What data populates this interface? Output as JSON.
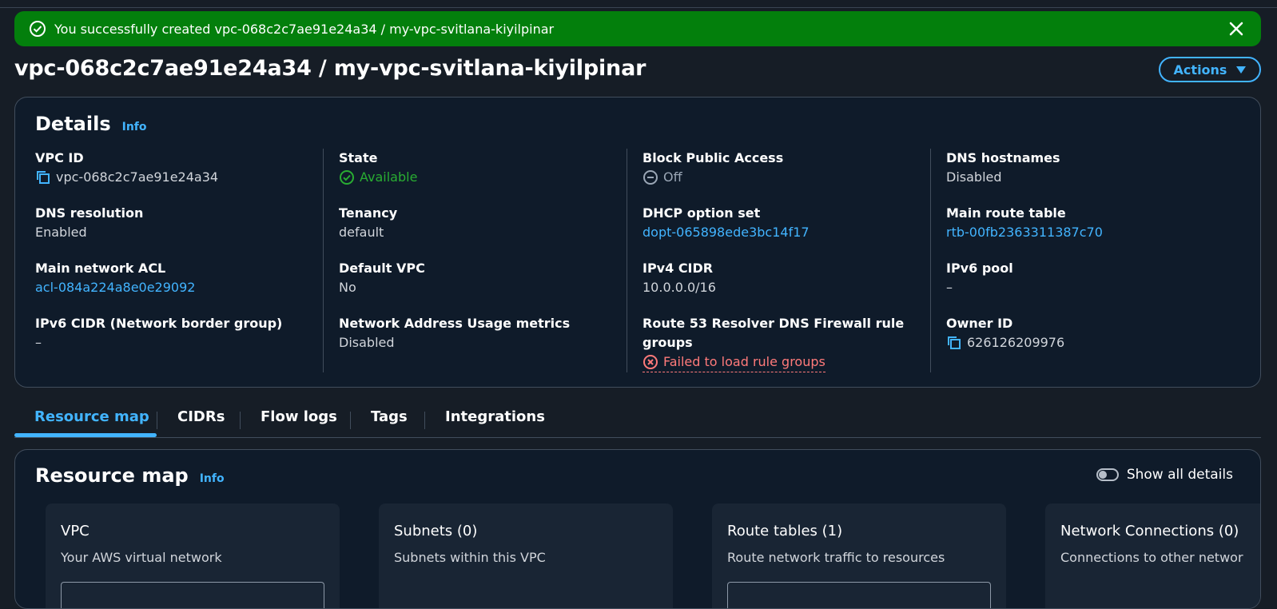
{
  "flash": {
    "message": "You successfully created vpc-068c2c7ae91e24a34 / my-vpc-svitlana-kiyilpinar"
  },
  "header": {
    "title": "vpc-068c2c7ae91e24a34 / my-vpc-svitlana-kiyilpinar",
    "actions_label": "Actions"
  },
  "details": {
    "heading": "Details",
    "info": "Info",
    "vpc_id": {
      "label": "VPC ID",
      "value": "vpc-068c2c7ae91e24a34"
    },
    "dns_resolution": {
      "label": "DNS resolution",
      "value": "Enabled"
    },
    "main_network_acl": {
      "label": "Main network ACL",
      "value": "acl-084a224a8e0e29092"
    },
    "ipv6_cidr_nbg": {
      "label": "IPv6 CIDR (Network border group)",
      "value": "–"
    },
    "state": {
      "label": "State",
      "value": "Available"
    },
    "tenancy": {
      "label": "Tenancy",
      "value": "default"
    },
    "default_vpc": {
      "label": "Default VPC",
      "value": "No"
    },
    "nau_metrics": {
      "label": "Network Address Usage metrics",
      "value": "Disabled"
    },
    "block_public_access": {
      "label": "Block Public Access",
      "value": "Off"
    },
    "dhcp_option_set": {
      "label": "DHCP option set",
      "value": "dopt-065898ede3bc14f17"
    },
    "ipv4_cidr": {
      "label": "IPv4 CIDR",
      "value": "10.0.0.0/16"
    },
    "route53_firewall": {
      "label_line1": "Route 53 Resolver DNS Firewall rule",
      "label_line2": "groups",
      "value": "Failed to load rule groups"
    },
    "dns_hostnames": {
      "label": "DNS hostnames",
      "value": "Disabled"
    },
    "main_route_table": {
      "label": "Main route table",
      "value": "rtb-00fb2363311387c70"
    },
    "ipv6_pool": {
      "label": "IPv6 pool",
      "value": "–"
    },
    "owner_id": {
      "label": "Owner ID",
      "value": "626126209976"
    }
  },
  "tabs": [
    "Resource map",
    "CIDRs",
    "Flow logs",
    "Tags",
    "Integrations"
  ],
  "resource_map": {
    "heading": "Resource map",
    "info": "Info",
    "toggle_label": "Show all details",
    "columns": [
      {
        "title": "VPC",
        "desc": "Your AWS virtual network"
      },
      {
        "title": "Subnets (0)",
        "desc": "Subnets within this VPC"
      },
      {
        "title": "Route tables (1)",
        "desc": "Route network traffic to resources"
      },
      {
        "title": "Network Connections (0)",
        "desc": "Connections to other networ"
      }
    ]
  },
  "colors": {
    "success": "#037f0c",
    "link": "#42b4ff",
    "available": "#29ad32",
    "error": "#ff7a7a",
    "card_bg": "#0f1b2a",
    "page_bg": "#161d26"
  },
  "icons": {
    "flash": "success-check-icon",
    "close": "close-icon",
    "copy": "copy-icon",
    "state": "status-available-icon",
    "bpa": "status-off-icon",
    "err": "status-error-icon",
    "actions": "caret-down-icon"
  }
}
